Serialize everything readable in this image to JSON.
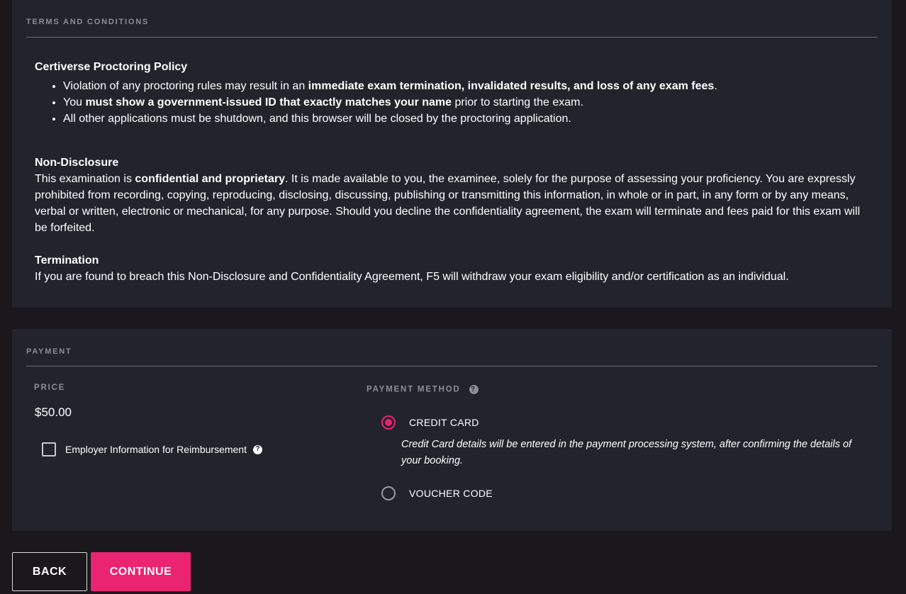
{
  "terms": {
    "heading": "TERMS AND CONDITIONS",
    "policy_title": "Certiverse Proctoring Policy",
    "bullets": [
      {
        "pre": "Violation of any proctoring rules may result in an ",
        "bold": "immediate exam termination, invalidated results, and loss of any exam fees",
        "post": "."
      },
      {
        "pre": "You ",
        "bold": "must show a government-issued ID that exactly matches your name",
        "post": " prior to starting the exam."
      },
      {
        "pre": "All other applications must be shutdown, and this browser will be closed by the proctoring application.",
        "bold": "",
        "post": ""
      }
    ],
    "nda_title": "Non-Disclosure",
    "nda_pre": "This examination is ",
    "nda_bold": "confidential and proprietary",
    "nda_post": ". It is made available to you, the examinee, solely for the purpose of assessing your proficiency. You are expressly prohibited from recording, copying, reproducing, disclosing, discussing, publishing or transmitting this information, in whole or in part, in any form or by any means, verbal or written, electronic or mechanical, for any purpose. Should you decline the confidentiality agreement, the exam will terminate and fees paid for this exam will be forfeited.",
    "termination_title": "Termination",
    "termination_text": "If you are found to breach this Non-Disclosure and Confidentiality Agreement, F5 will withdraw your exam eligibility and/or certification as an individual."
  },
  "payment": {
    "heading": "PAYMENT",
    "price_label": "PRICE",
    "price_value": "$50.00",
    "employer_checkbox_label": "Employer Information for Reimbursement",
    "employer_checked": false,
    "method_label": "PAYMENT METHOD",
    "help_glyph": "?",
    "methods": [
      {
        "label": "CREDIT CARD",
        "selected": true
      },
      {
        "label": "VOUCHER CODE",
        "selected": false
      }
    ],
    "credit_card_note": "Credit Card details will be entered in the payment processing system, after confirming the details of your booking."
  },
  "actions": {
    "back_label": "BACK",
    "continue_label": "CONTINUE"
  },
  "colors": {
    "accent": "#ea2471",
    "panel_bg": "#23232c",
    "page_bg": "#1a181d",
    "muted_text": "#8e8e97"
  },
  "icons": {
    "help": "question-circle-icon",
    "radio_selected": "radio-selected-icon",
    "radio_unselected": "radio-unselected-icon"
  }
}
